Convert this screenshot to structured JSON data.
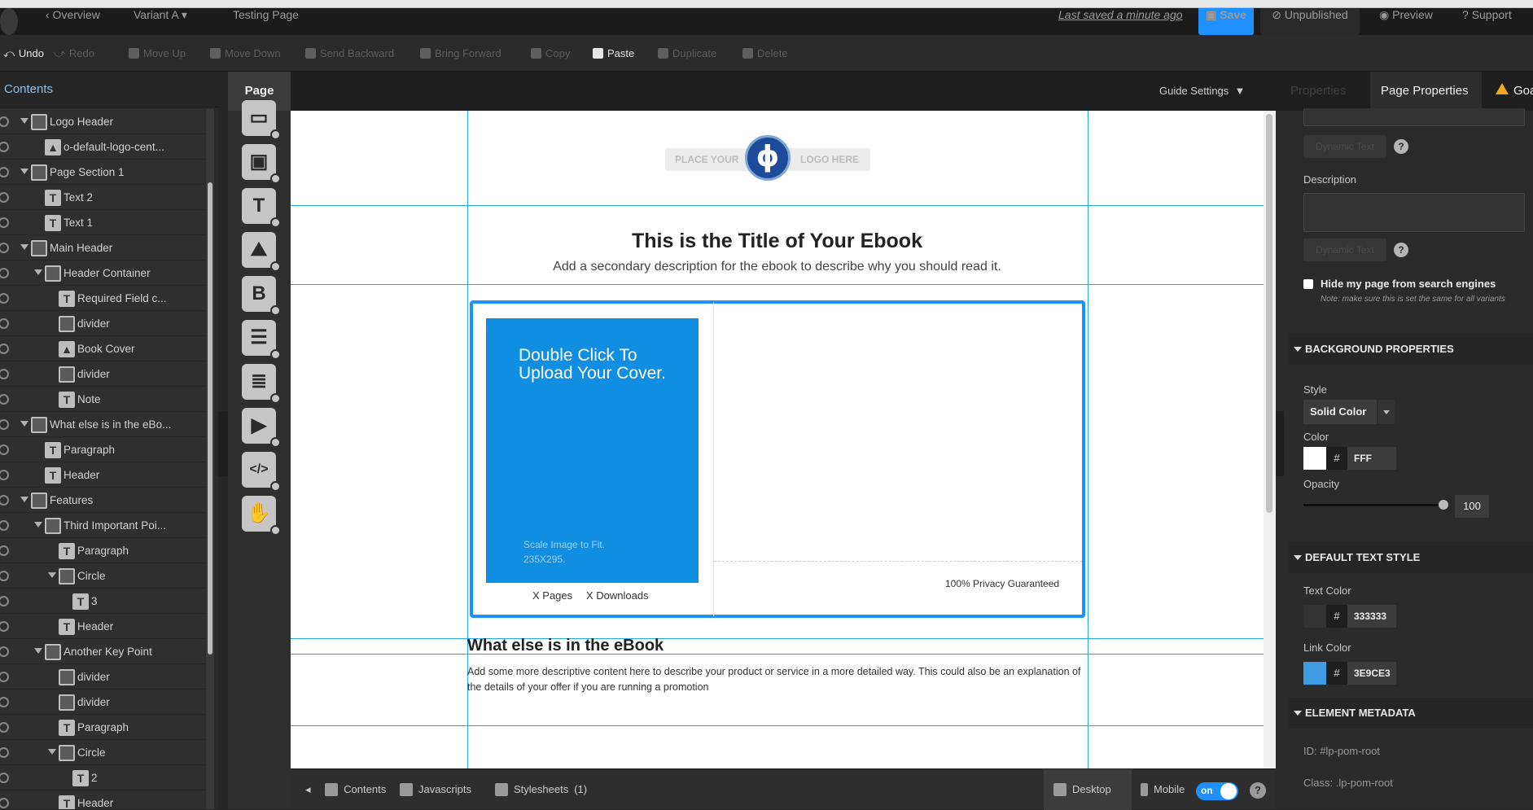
{
  "topbar": {
    "overview": "‹ Overview",
    "variant": "Variant A",
    "page_name": "Testing Page",
    "last_saved": "Last saved  a minute ago",
    "save": "Save",
    "unpublished": "Unpublished",
    "preview": "Preview",
    "support": "Support"
  },
  "toolbar": {
    "undo": "Undo",
    "redo": "Redo",
    "move_up": "Move Up",
    "move_down": "Move Down",
    "send_backward": "Send Backward",
    "bring_forward": "Bring Forward",
    "copy": "Copy",
    "paste": "Paste",
    "duplicate": "Duplicate",
    "delete": "Delete"
  },
  "contents": {
    "title": "Contents",
    "tree": [
      {
        "label": "Logo Header",
        "depth": 0,
        "icon": "section",
        "expanded": true
      },
      {
        "label": "o-default-logo-cent...",
        "depth": 1,
        "icon": "image"
      },
      {
        "label": "Page Section 1",
        "depth": 0,
        "icon": "section",
        "expanded": true
      },
      {
        "label": "Text 2",
        "depth": 1,
        "icon": "text"
      },
      {
        "label": "Text 1",
        "depth": 1,
        "icon": "text"
      },
      {
        "label": "Main Header",
        "depth": 0,
        "icon": "section",
        "expanded": true
      },
      {
        "label": "Header Container",
        "depth": 1,
        "icon": "box",
        "expanded": true
      },
      {
        "label": "Required Field c...",
        "depth": 2,
        "icon": "text"
      },
      {
        "label": "divider",
        "depth": 2,
        "icon": "box"
      },
      {
        "label": "Book Cover",
        "depth": 2,
        "icon": "image"
      },
      {
        "label": "divider",
        "depth": 2,
        "icon": "box"
      },
      {
        "label": "Note",
        "depth": 2,
        "icon": "text"
      },
      {
        "label": "What else is in the eBo...",
        "depth": 0,
        "icon": "section",
        "expanded": true
      },
      {
        "label": "Paragraph",
        "depth": 1,
        "icon": "text"
      },
      {
        "label": "Header",
        "depth": 1,
        "icon": "text"
      },
      {
        "label": "Features",
        "depth": 0,
        "icon": "section",
        "expanded": true
      },
      {
        "label": "Third Important Poi...",
        "depth": 1,
        "icon": "box",
        "expanded": true
      },
      {
        "label": "Paragraph",
        "depth": 2,
        "icon": "text"
      },
      {
        "label": "Circle",
        "depth": 2,
        "icon": "box",
        "expanded": true
      },
      {
        "label": "3",
        "depth": 3,
        "icon": "text"
      },
      {
        "label": "Header",
        "depth": 2,
        "icon": "text"
      },
      {
        "label": "Another Key Point",
        "depth": 1,
        "icon": "box",
        "expanded": true
      },
      {
        "label": "divider",
        "depth": 2,
        "icon": "box"
      },
      {
        "label": "divider",
        "depth": 2,
        "icon": "box"
      },
      {
        "label": "Paragraph",
        "depth": 2,
        "icon": "text"
      },
      {
        "label": "Circle",
        "depth": 2,
        "icon": "box",
        "expanded": true
      },
      {
        "label": "2",
        "depth": 3,
        "icon": "text"
      },
      {
        "label": "Header",
        "depth": 2,
        "icon": "text"
      }
    ]
  },
  "widgets": {
    "page_tab": "Page",
    "items": [
      {
        "icon": "section-widget-icon",
        "glyph": "▭"
      },
      {
        "icon": "box-widget-icon",
        "glyph": "▣"
      },
      {
        "icon": "text-widget-icon",
        "glyph": "T"
      },
      {
        "icon": "image-widget-icon",
        "glyph": "⛰"
      },
      {
        "icon": "button-widget-icon",
        "glyph": "B"
      },
      {
        "icon": "form-widget-icon",
        "glyph": "☰"
      },
      {
        "icon": "lightbox-widget-icon",
        "glyph": "≣"
      },
      {
        "icon": "video-widget-icon",
        "glyph": "▶"
      },
      {
        "icon": "html-widget-icon",
        "glyph": "</>"
      },
      {
        "icon": "social-widget-icon",
        "glyph": "✋"
      }
    ]
  },
  "canvas": {
    "guide_settings": "Guide Settings",
    "logo_left": "PLACE YOUR",
    "logo_right": "LOGO HERE",
    "logo_mark": "ϕ",
    "title": "This is the Title of Your Ebook",
    "subtitle": "Add a secondary description for the ebook to describe why you should read it.",
    "cover_text": "Double Click To Upload Your Cover.",
    "cover_scale_1": "Scale Image to Fit.",
    "cover_scale_2": "235X295.",
    "x_pages": "X Pages",
    "x_downloads": "X Downloads",
    "privacy": "100% Privacy Guaranteed",
    "section_head": "What else is in the eBook",
    "section_para": "Add some more descriptive content here to describe your product or service in a more detailed way. This could also be an explanation of the details of your offer if you are running a promotion"
  },
  "bottom": {
    "contents": "Contents",
    "javascripts": "Javascripts",
    "stylesheets": "Stylesheets",
    "stylesheets_count": "(1)",
    "desktop": "Desktop",
    "mobile": "Mobile",
    "toggle": "on",
    "help": "?"
  },
  "right_panel": {
    "tabs": {
      "properties": "Properties",
      "page_properties": "Page Properties",
      "goals": "Goa"
    },
    "dynamic_text": "Dynamic Text",
    "description_label": "Description",
    "hide_label": "Hide my page from search engines",
    "hide_note": "Note: make sure this is set the same for all variants",
    "background_section": "BACKGROUND PROPERTIES",
    "style_label": "Style",
    "style_value": "Solid Color",
    "color_label": "Color",
    "bg_color_hex": "FFF",
    "opacity_label": "Opacity",
    "opacity_value": "100",
    "default_text_section": "DEFAULT TEXT STYLE",
    "text_color_label": "Text Color",
    "text_color_hex": "333333",
    "link_color_label": "Link Color",
    "link_color_hex": "3E9CE3",
    "metadata_section": "ELEMENT METADATA",
    "meta_id": "ID:  #lp-pom-root",
    "meta_class": "Class:  .lp-pom-root",
    "hash": "#",
    "help": "?"
  },
  "colors": {
    "accent": "#1e90ff",
    "cover_blue": "#0f8ee2",
    "guide_line": "#29a8e0",
    "link_color": "#3E9CE3",
    "text_color": "#333333",
    "bg_color": "#FFFFFF"
  }
}
